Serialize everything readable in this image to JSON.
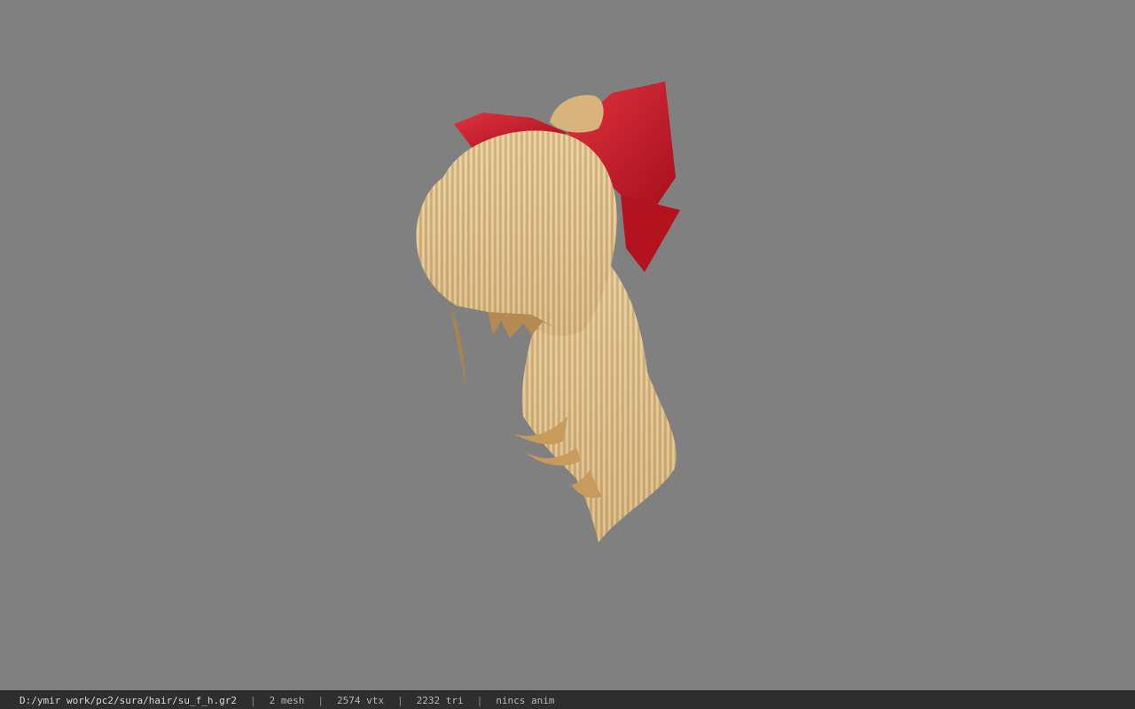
{
  "viewer": {
    "background_color": "#808080",
    "model_icon": "hair-model-with-red-bow",
    "status": {
      "file_path": "D:/ymir work/pc2/sura/hair/su_f_h.gr2",
      "separator": "|",
      "mesh_count": "2 mesh",
      "vertex_count": "2574 vtx",
      "triangle_count": "2232 tri",
      "anim_status": "nincs anim"
    }
  }
}
